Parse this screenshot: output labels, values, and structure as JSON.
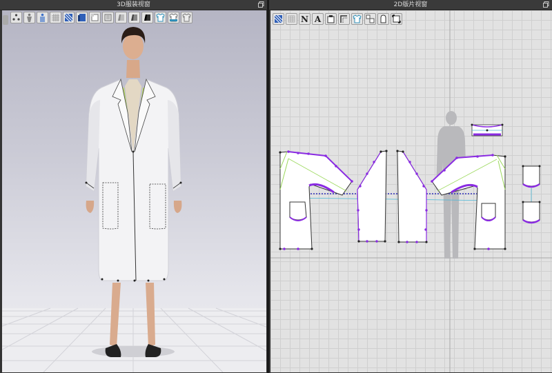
{
  "left_panel": {
    "title": "3D服装视窗",
    "toolbar_icons": [
      "collapse-arrow-icon",
      "avatar-points-icon",
      "avatar-icon",
      "fabric-avatar-icon",
      "grid-icon",
      "texture-icon",
      "thickness-icon",
      "surface-icon",
      "shade-icon",
      "shade-dark-icon",
      "shade-black-icon",
      "garment-front-icon",
      "garment-side-icon",
      "garment-back-icon"
    ]
  },
  "right_panel": {
    "title": "2D版片视窗",
    "toolbar_icons": [
      "texture-icon",
      "mesh-icon",
      "text-n-icon",
      "text-a-icon",
      "annotation-icon",
      "seam-icon",
      "garment-icon",
      "layout-icon",
      "shape-icon",
      "select-icon"
    ],
    "text_labels": [
      "N",
      "A"
    ]
  }
}
